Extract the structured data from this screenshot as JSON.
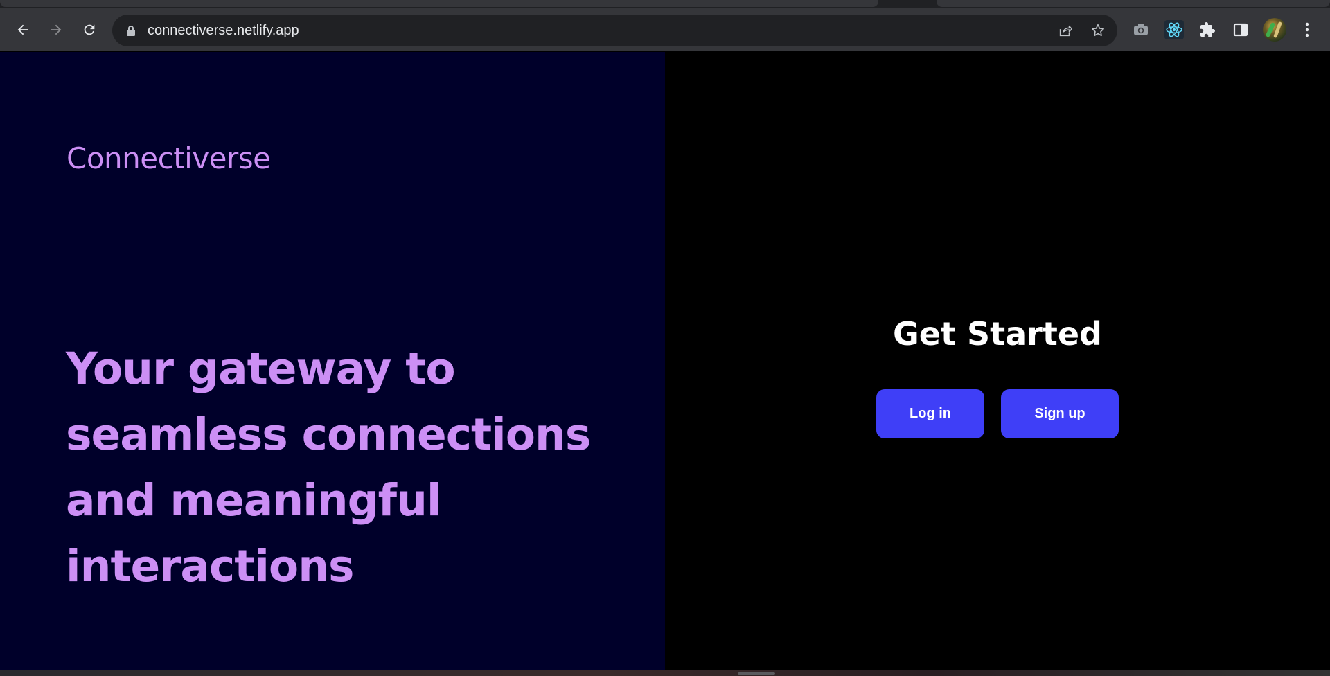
{
  "browser": {
    "url": "connectiverse.netlify.app",
    "icons": {
      "back": "arrow-left-icon",
      "forward": "arrow-right-icon",
      "reload": "reload-icon",
      "lock": "lock-icon",
      "share": "share-icon",
      "bookmark": "star-icon",
      "screenshot": "camera-icon",
      "react_devtools": "react-icon",
      "extensions": "puzzle-icon",
      "side_panel": "side-panel-icon",
      "menu": "kebab-menu-icon"
    }
  },
  "page": {
    "brand": "Connectiverse",
    "headline": [
      "Your gateway to",
      "seamless connections",
      "and meaningful",
      "interactions"
    ],
    "cta_heading": "Get Started",
    "login_label": "Log in",
    "signup_label": "Sign up"
  },
  "colors": {
    "left_bg": "#00002a",
    "right_bg": "#000000",
    "accent_text": "#cc8ff5",
    "button_bg": "#3f3ff7",
    "button_text": "#ffffff"
  }
}
